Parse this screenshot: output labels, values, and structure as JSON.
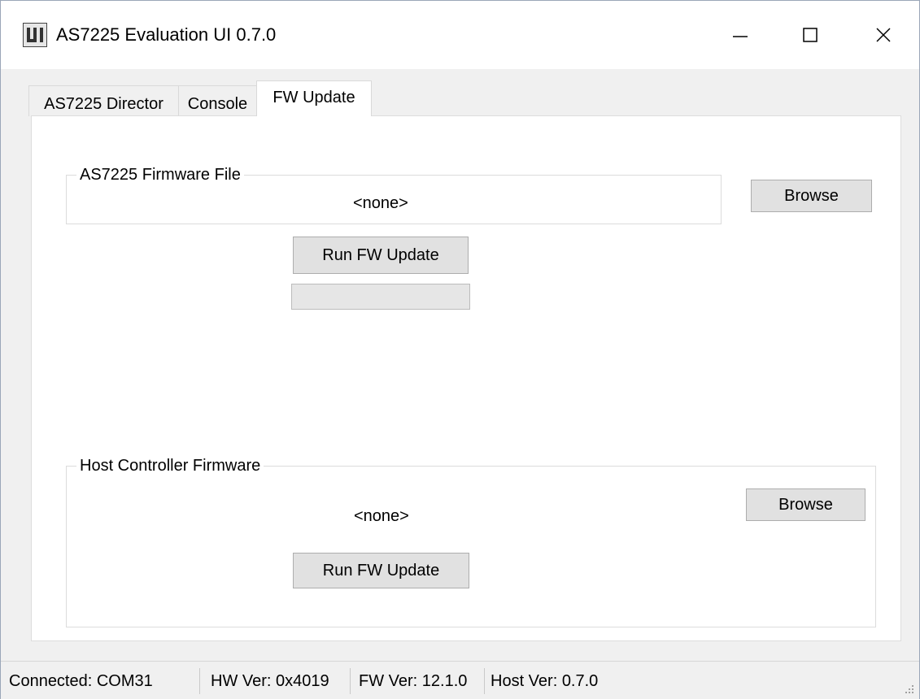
{
  "window": {
    "title": "AS7225 Evaluation UI 0.7.0",
    "icon": "app-logo-icon",
    "controls": [
      "minimize-icon",
      "maximize-icon",
      "close-icon"
    ]
  },
  "tabs": [
    {
      "label": "AS7225 Director",
      "active": false
    },
    {
      "label": "Console",
      "active": false
    },
    {
      "label": "FW Update",
      "active": true
    }
  ],
  "as7225_firmware": {
    "group_title": "AS7225 Firmware File",
    "file_value": "<none>",
    "browse_label": "Browse",
    "run_label": "Run FW Update",
    "progress": 0
  },
  "host_firmware": {
    "group_title": "Host Controller Firmware",
    "file_value": "<none>",
    "browse_label": "Browse",
    "run_label": "Run FW Update"
  },
  "statusbar": {
    "connected": "Connected: COM31",
    "hw_ver": "HW Ver: 0x4019",
    "fw_ver": "FW Ver: 12.1.0",
    "host_ver": "Host Ver: 0.7.0"
  },
  "colors": {
    "window_bg": "#f0f0f0",
    "panel_bg": "#ffffff",
    "button_bg": "#e1e1e1",
    "border": "#dcdcdc"
  }
}
